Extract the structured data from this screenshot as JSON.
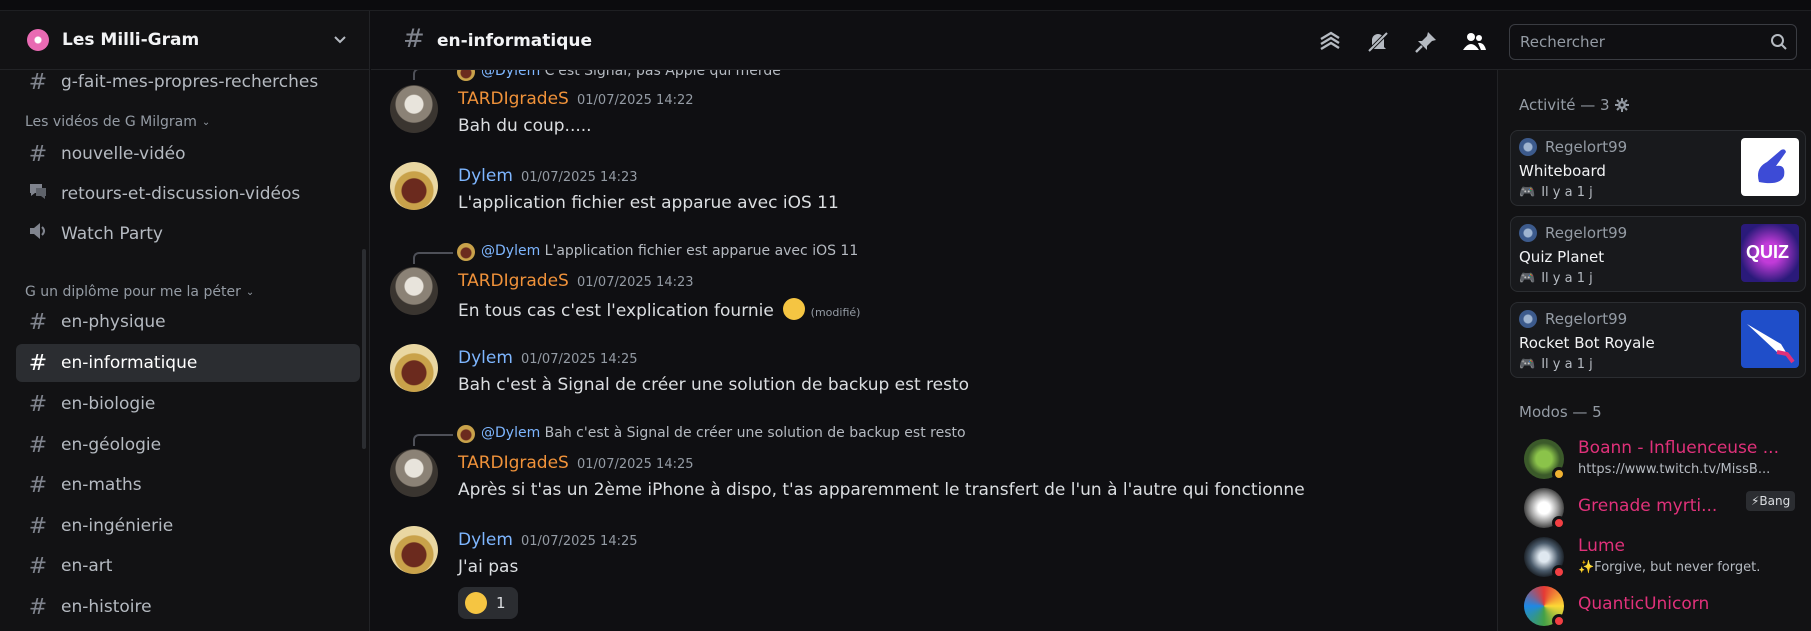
{
  "server": {
    "name": "Les Milli-Gram"
  },
  "sidebar": {
    "top_partial": "g-fait-mes-propres-recherches",
    "category1": "Les vidéos de G Milgram",
    "cat1_items": [
      "nouvelle-vidéo",
      "retours-et-discussion-vidéos",
      "Watch Party"
    ],
    "category2": "G un diplôme pour me la péter",
    "cat2_items": [
      "en-physique",
      "en-informatique",
      "en-biologie",
      "en-géologie",
      "en-maths",
      "en-ingénierie",
      "en-art",
      "en-histoire"
    ]
  },
  "header": {
    "channel": "en-informatique",
    "search_placeholder": "Rechercher"
  },
  "messages": [
    {
      "reply_author": "@Dylem",
      "reply_text": "C'est Signal, pas Apple qui merde",
      "author": "TARDIgradeS",
      "time": "01/07/2025 14:22",
      "text": "Bah du coup....."
    },
    {
      "author": "Dylem",
      "time": "01/07/2025 14:23",
      "text": "L'application fichier est apparue avec iOS 11"
    },
    {
      "reply_author": "@Dylem",
      "reply_text": "L'application fichier est apparue avec iOS 11",
      "author": "TARDIgradeS",
      "time": "01/07/2025 14:23",
      "text": "En tous cas c'est l'explication fournie",
      "edited": "(modifié)"
    },
    {
      "author": "Dylem",
      "time": "01/07/2025 14:25",
      "text": "Bah c'est à Signal de créer une solution de backup est resto"
    },
    {
      "reply_author": "@Dylem",
      "reply_text": "Bah c'est à Signal de créer une solution de backup est resto",
      "author": "TARDIgradeS",
      "time": "01/07/2025 14:25",
      "text": "Après si t'as un 2ème iPhone à dispo, t'as apparemment le transfert de l'un à l'autre qui fonctionne"
    },
    {
      "author": "Dylem",
      "time": "01/07/2025 14:25",
      "text": "J'ai pas",
      "reaction_count": "1"
    }
  ],
  "right_panel": {
    "activity_title": "Activité — 3",
    "activities": [
      {
        "user": "Regelort99",
        "game": "Whiteboard",
        "time": "Il y a 1 j"
      },
      {
        "user": "Regelort99",
        "game": "Quiz Planet",
        "time": "Il y a 1 j"
      },
      {
        "user": "Regelort99",
        "game": "Rocket Bot Royale",
        "time": "Il y a 1 j"
      }
    ],
    "quiz_thumb_text": "QUIZ",
    "mods_title": "Modos — 5",
    "mods": [
      {
        "name": "Boann - Influenceuse ...",
        "sub": "https://www.twitch.tv/MissB..."
      },
      {
        "name": "Grenade myrti...",
        "tag": "⚡Bang"
      },
      {
        "name": "Lume",
        "sub": "✨Forgive, but never forget."
      },
      {
        "name": "QuanticUnicorn"
      }
    ]
  },
  "colors": {
    "accent_orange": "#f0923a",
    "accent_blue": "#7eb6ff",
    "mod_pink": "#e0317a",
    "background": "#0f0f12"
  }
}
